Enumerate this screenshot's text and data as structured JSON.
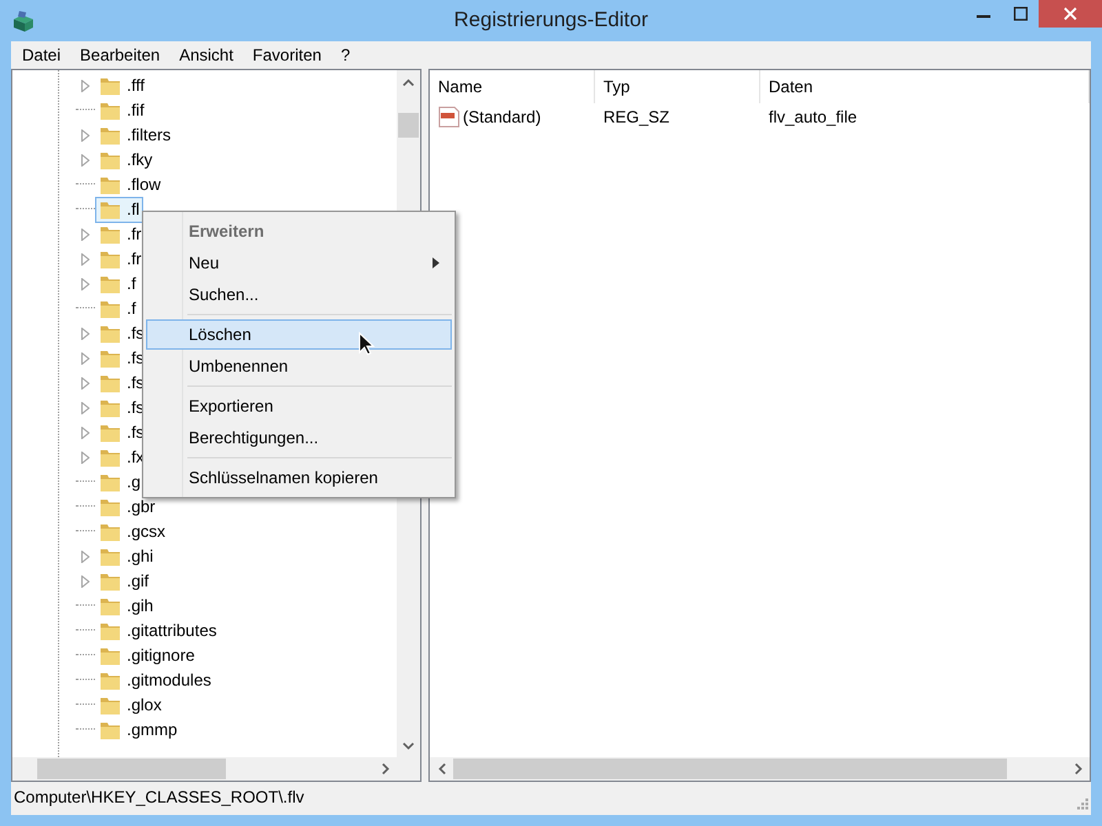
{
  "window": {
    "title": "Registrierungs-Editor"
  },
  "menu": [
    "Datei",
    "Bearbeiten",
    "Ansicht",
    "Favoriten",
    "?"
  ],
  "tree": {
    "items": [
      {
        "label": ".fff",
        "has_children": true,
        "selected": false
      },
      {
        "label": ".fif",
        "has_children": false,
        "selected": false
      },
      {
        "label": ".filters",
        "has_children": true,
        "selected": false
      },
      {
        "label": ".fky",
        "has_children": true,
        "selected": false
      },
      {
        "label": ".flow",
        "has_children": false,
        "selected": false
      },
      {
        "label": ".fl",
        "has_children": false,
        "selected": true
      },
      {
        "label": ".fr",
        "has_children": true,
        "selected": false
      },
      {
        "label": ".fr",
        "has_children": true,
        "selected": false
      },
      {
        "label": ".f",
        "has_children": true,
        "selected": false
      },
      {
        "label": ".f",
        "has_children": false,
        "selected": false
      },
      {
        "label": ".fs",
        "has_children": true,
        "selected": false
      },
      {
        "label": ".fs",
        "has_children": true,
        "selected": false
      },
      {
        "label": ".fs",
        "has_children": true,
        "selected": false
      },
      {
        "label": ".fs",
        "has_children": true,
        "selected": false
      },
      {
        "label": ".fs",
        "has_children": true,
        "selected": false
      },
      {
        "label": ".fx",
        "has_children": true,
        "selected": false
      },
      {
        "label": ".g",
        "has_children": false,
        "selected": false
      },
      {
        "label": ".gbr",
        "has_children": false,
        "selected": false
      },
      {
        "label": ".gcsx",
        "has_children": false,
        "selected": false
      },
      {
        "label": ".ghi",
        "has_children": true,
        "selected": false
      },
      {
        "label": ".gif",
        "has_children": true,
        "selected": false
      },
      {
        "label": ".gih",
        "has_children": false,
        "selected": false
      },
      {
        "label": ".gitattributes",
        "has_children": false,
        "selected": false
      },
      {
        "label": ".gitignore",
        "has_children": false,
        "selected": false
      },
      {
        "label": ".gitmodules",
        "has_children": false,
        "selected": false
      },
      {
        "label": ".glox",
        "has_children": false,
        "selected": false
      },
      {
        "label": ".gmmp",
        "has_children": false,
        "selected": false
      }
    ]
  },
  "list": {
    "columns": [
      "Name",
      "Typ",
      "Daten"
    ],
    "rows": [
      {
        "name": "(Standard)",
        "type": "REG_SZ",
        "data": "flv_auto_file"
      }
    ]
  },
  "context_menu": {
    "items": [
      {
        "kind": "item",
        "label": "Erweitern",
        "default": true,
        "submenu": false,
        "selected": false
      },
      {
        "kind": "item",
        "label": "Neu",
        "default": false,
        "submenu": true,
        "selected": false
      },
      {
        "kind": "item",
        "label": "Suchen...",
        "default": false,
        "submenu": false,
        "selected": false
      },
      {
        "kind": "separator"
      },
      {
        "kind": "item",
        "label": "Löschen",
        "default": false,
        "submenu": false,
        "selected": true
      },
      {
        "kind": "item",
        "label": "Umbenennen",
        "default": false,
        "submenu": false,
        "selected": false
      },
      {
        "kind": "separator"
      },
      {
        "kind": "item",
        "label": "Exportieren",
        "default": false,
        "submenu": false,
        "selected": false
      },
      {
        "kind": "item",
        "label": "Berechtigungen...",
        "default": false,
        "submenu": false,
        "selected": false
      },
      {
        "kind": "separator"
      },
      {
        "kind": "item",
        "label": "Schlüsselnamen kopieren",
        "default": false,
        "submenu": false,
        "selected": false
      }
    ]
  },
  "status_bar": "Computer\\HKEY_CLASSES_ROOT\\.flv"
}
